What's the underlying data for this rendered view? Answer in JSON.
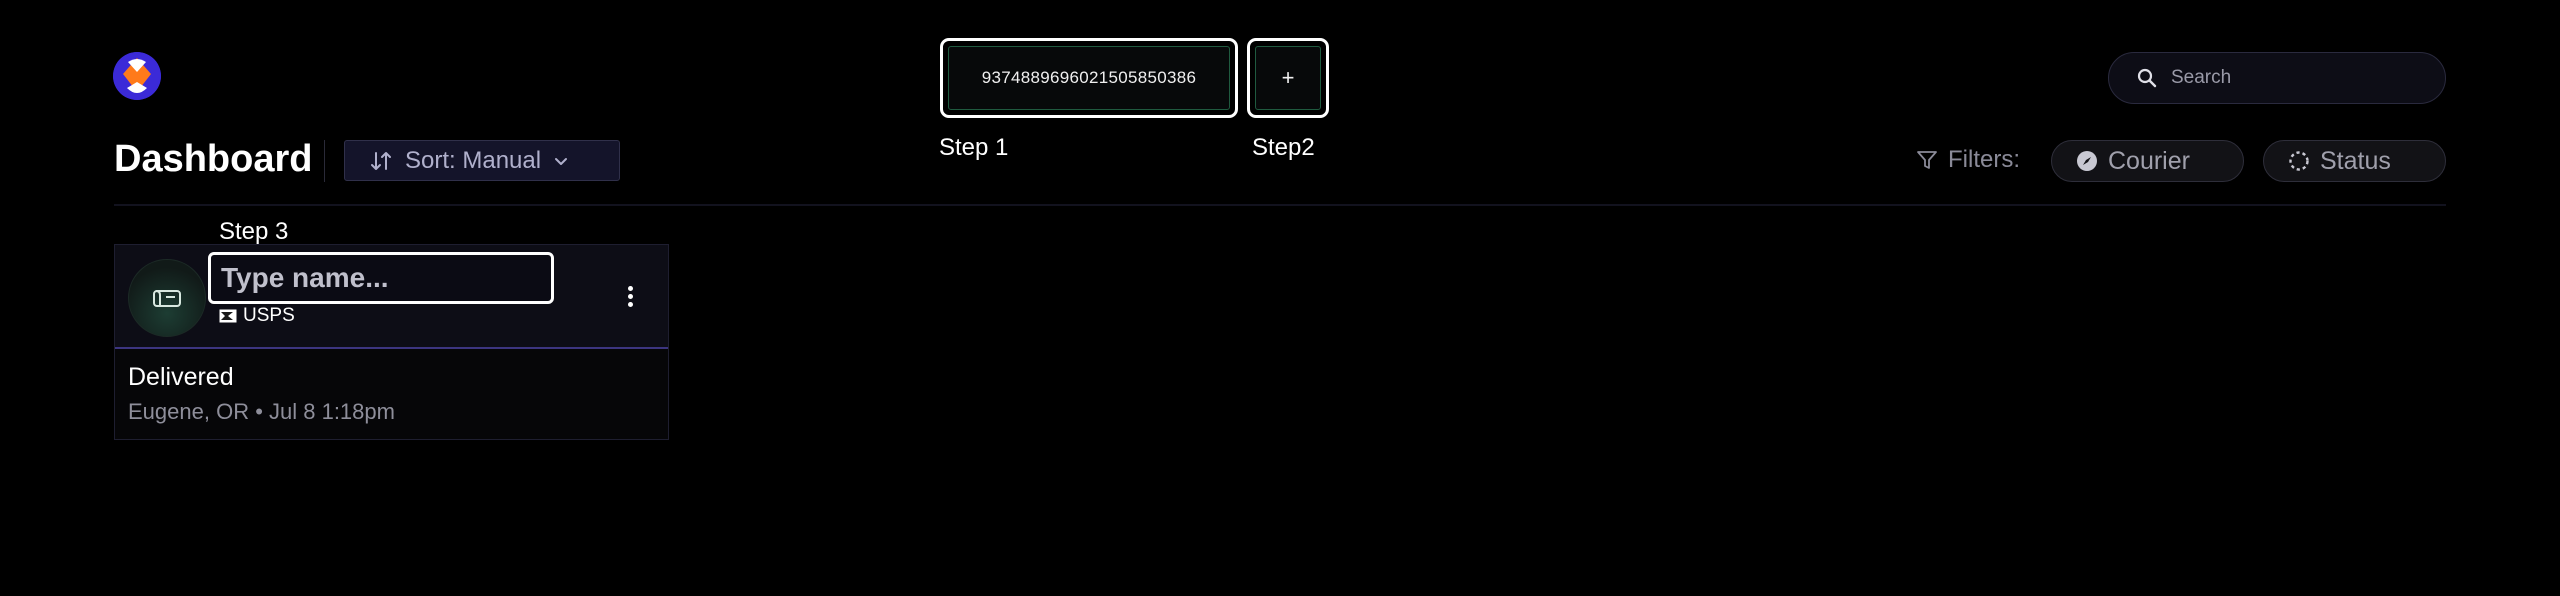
{
  "header": {
    "logo": "app-logo",
    "tracking_number": "9374889696021505850386",
    "add_label": "+",
    "step1": "Step 1",
    "step2": "Step2",
    "search": {
      "placeholder": "Search",
      "icon": "search-icon"
    }
  },
  "toolbar": {
    "page_title": "Dashboard",
    "sort_label": "Sort: Manual",
    "sort_icon": "sort-arrows-icon",
    "filters_label": "Filters:",
    "filters_icon": "funnel-icon",
    "filter_chips": [
      {
        "label": "Courier",
        "icon": "compass-icon"
      },
      {
        "label": "Status",
        "icon": "dashed-circle-icon"
      }
    ]
  },
  "card": {
    "step3": "Step 3",
    "name_placeholder": "Type name...",
    "courier": "USPS",
    "status": "Delivered",
    "location": "Eugene, OR • Jul 8 1:18pm"
  },
  "colors": {
    "background": "#000000",
    "accent": "#3c3580",
    "focus_outline": "#ffffff",
    "input_border": "#1f5a3f"
  }
}
